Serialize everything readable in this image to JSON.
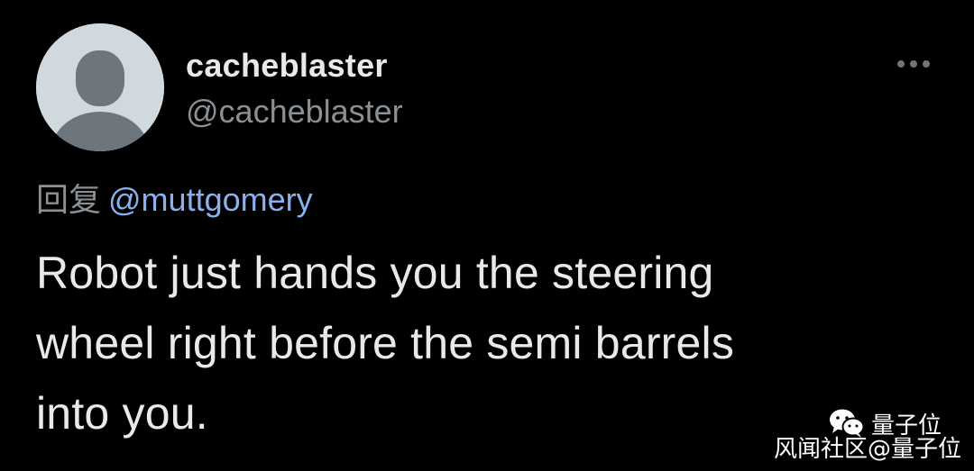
{
  "tweet": {
    "author": {
      "display_name": "cacheblaster",
      "handle": "@cacheblaster",
      "avatar_icon": "default-profile-icon"
    },
    "more_icon": "more-horizontal-icon",
    "reply": {
      "prefix": "回复",
      "mention": "@muttgomery"
    },
    "text_lines": [
      "Robot just hands you the steering",
      "wheel right before the semi barrels",
      "into you."
    ]
  },
  "watermark": {
    "logo_icon": "wechat-icon",
    "brand": "量子位",
    "source": "风闻社区@量子位"
  },
  "colors": {
    "background": "#000000",
    "text_primary": "#e7e9ea",
    "text_secondary": "#8b9094",
    "link": "#8ab0ee",
    "avatar_bg": "#cfd9de",
    "avatar_fg": "#6e767d"
  }
}
